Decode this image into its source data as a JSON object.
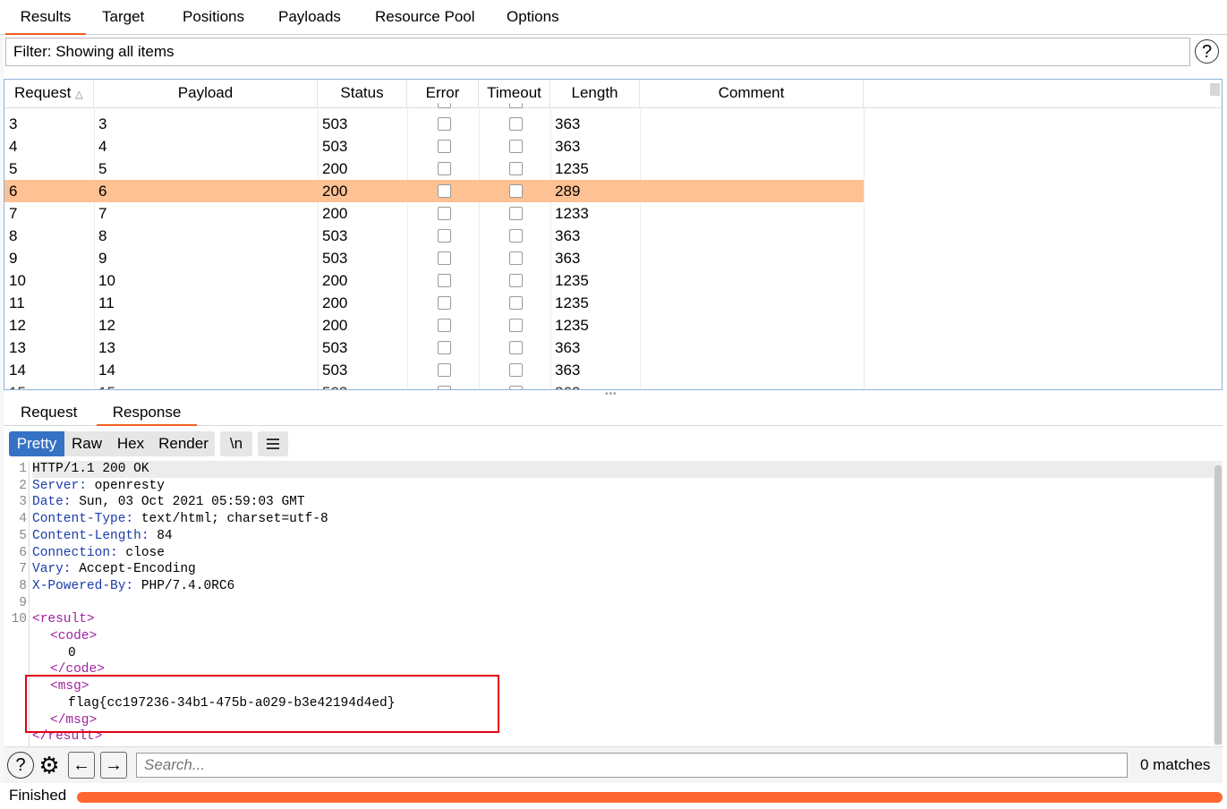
{
  "top_tabs": [
    "Results",
    "Target",
    "Positions",
    "Payloads",
    "Resource Pool",
    "Options"
  ],
  "filter": {
    "text": "Filter: Showing all items",
    "help": "?"
  },
  "table": {
    "columns": [
      "Request",
      "Payload",
      "Status",
      "Error",
      "Timeout",
      "Length",
      "Comment"
    ],
    "sort_indicator": "^",
    "rows": [
      {
        "request": "3",
        "payload": "3",
        "status": "503",
        "length": "363"
      },
      {
        "request": "4",
        "payload": "4",
        "status": "503",
        "length": "363"
      },
      {
        "request": "5",
        "payload": "5",
        "status": "200",
        "length": "1235"
      },
      {
        "request": "6",
        "payload": "6",
        "status": "200",
        "length": "289",
        "selected": true
      },
      {
        "request": "7",
        "payload": "7",
        "status": "200",
        "length": "1233"
      },
      {
        "request": "8",
        "payload": "8",
        "status": "503",
        "length": "363"
      },
      {
        "request": "9",
        "payload": "9",
        "status": "503",
        "length": "363"
      },
      {
        "request": "10",
        "payload": "10",
        "status": "200",
        "length": "1235"
      },
      {
        "request": "11",
        "payload": "11",
        "status": "200",
        "length": "1235"
      },
      {
        "request": "12",
        "payload": "12",
        "status": "200",
        "length": "1235"
      },
      {
        "request": "13",
        "payload": "13",
        "status": "503",
        "length": "363"
      },
      {
        "request": "14",
        "payload": "14",
        "status": "503",
        "length": "363"
      }
    ],
    "selected_row_color": "#fec193"
  },
  "message_tabs": [
    "Request",
    "Response"
  ],
  "view_buttons": [
    "Pretty",
    "Raw",
    "Hex",
    "Render"
  ],
  "newline_button": "\\n",
  "response_lines": [
    {
      "n": "1",
      "key": "HTTP/1.1 200 OK",
      "val": ""
    },
    {
      "n": "2",
      "key": "Server:",
      "val": " openresty"
    },
    {
      "n": "3",
      "key": "Date:",
      "val": " Sun, 03 Oct 2021 05:59:03 GMT"
    },
    {
      "n": "4",
      "key": "Content-Type:",
      "val": " text/html; charset=utf-8"
    },
    {
      "n": "5",
      "key": "Content-Length:",
      "val": " 84"
    },
    {
      "n": "6",
      "key": "Connection:",
      "val": " close"
    },
    {
      "n": "7",
      "key": "Vary:",
      "val": " Accept-Encoding"
    },
    {
      "n": "8",
      "key": "X-Powered-By:",
      "val": " PHP/7.4.0RC6"
    },
    {
      "n": "9",
      "key": "",
      "val": ""
    },
    {
      "n": "10",
      "key": "",
      "val": "<result>"
    }
  ],
  "xml_body": {
    "code_open": "<code>",
    "code_value": "0",
    "code_close": "</code>",
    "msg_open": "<msg>",
    "msg_value": "flag{cc197236-34b1-475b-a029-b3e42194d4ed}",
    "msg_close": "</msg>",
    "result_close": "</result>"
  },
  "search": {
    "placeholder": "Search...",
    "matches": "0 matches"
  },
  "status": {
    "text": "Finished",
    "progress": 1.0,
    "progress_color": "#fe6630"
  },
  "accent_color": "#f06020"
}
